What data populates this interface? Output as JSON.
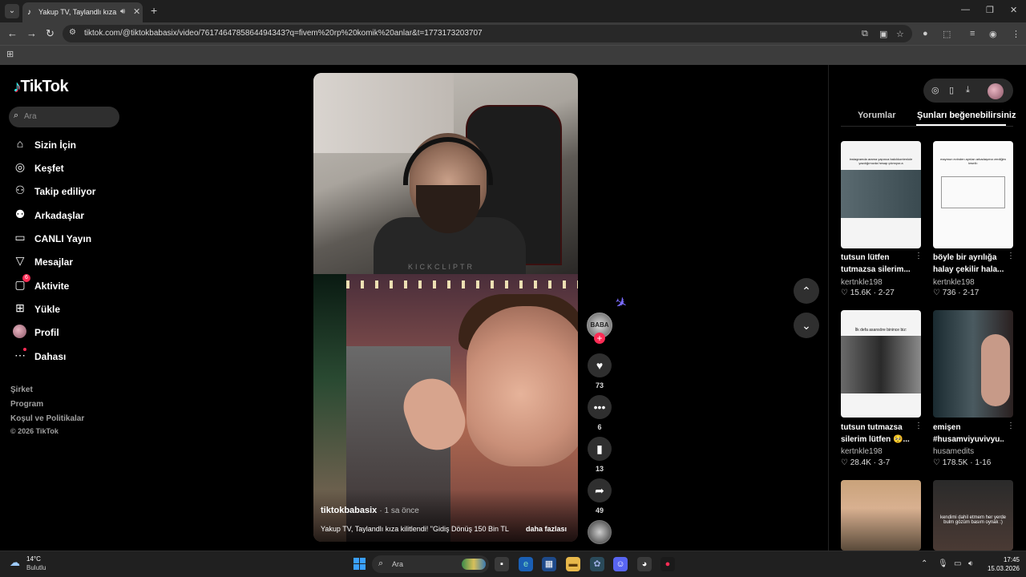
{
  "browser": {
    "tab_title": "Yakup TV, Taylandlı kıza kilit",
    "url": "tiktok.com/@tiktokbabasix/video/7617464785864494343?q=fivem%20rp%20komik%20anlar&t=1773173203707"
  },
  "sidebar": {
    "logo": "TikTok",
    "search_placeholder": "Ara",
    "items": [
      {
        "label": "Sizin İçin",
        "icon": "home-icon"
      },
      {
        "label": "Keşfet",
        "icon": "compass-icon"
      },
      {
        "label": "Takip ediliyor",
        "icon": "following-icon"
      },
      {
        "label": "Arkadaşlar",
        "icon": "friends-icon"
      },
      {
        "label": "CANLI Yayın",
        "icon": "live-icon"
      },
      {
        "label": "Mesajlar",
        "icon": "messages-icon"
      },
      {
        "label": "Aktivite",
        "icon": "activity-icon",
        "badge": "6"
      },
      {
        "label": "Yükle",
        "icon": "upload-icon"
      },
      {
        "label": "Profil",
        "icon": "profile-avatar"
      },
      {
        "label": "Dahası",
        "icon": "more-icon"
      }
    ],
    "footer": [
      "Şirket",
      "Program",
      "Koşul ve Politikalar",
      "© 2026 TikTok"
    ]
  },
  "video": {
    "watermark": "KICKCLIPTR",
    "author": "tiktokbabasix",
    "time": "· 1 sa önce",
    "caption": "Yakup TV, Taylandlı kıza kilitlendi! \"Gidiş Dönüş 150 Bin TL",
    "more": "daha fazlası"
  },
  "actions": {
    "likes": "73",
    "comments": "6",
    "saves": "13",
    "shares": "49"
  },
  "right_panel": {
    "tabs": [
      "Yorumlar",
      "Şunları beğenebilirsiniz"
    ],
    "active_tab": "Şunları beğenebilirsiniz",
    "cards": [
      {
        "title1": "tutsun lütfen",
        "title2": "tutmazsa silerim...",
        "author": "kertnkle198",
        "likes": "15.6K",
        "date": "2-27",
        "overlay": "instagramda arama yapınca bakılıkontenlole yazdığımızda hesap çıkmıyor.a"
      },
      {
        "title1": "böyle bir ayrılığa",
        "title2": "halay çekilir hala...",
        "author": "kertnkle198",
        "likes": "736",
        "date": "2-17",
        "overlay": "maymun evinden ayrılan arkadaşıma verdiğim tesellı:"
      },
      {
        "title1": "tutsun tutmazsa",
        "title2": "silerim lütfen 🥺...",
        "author": "kertnkle198",
        "likes": "28.4K",
        "date": "3-7",
        "overlay": "İlk defa asansöre binince biz:"
      },
      {
        "title1": "emişen",
        "title2": "#husamviyuvivyu...",
        "author": "husamedits",
        "likes": "178.5K",
        "date": "1-16",
        "overlay": ""
      },
      {
        "overlay": ""
      },
      {
        "overlay": "kendimi dahil etmem her yerde bulm gözüm basım oynak :)"
      }
    ]
  },
  "taskbar": {
    "temp": "14°C",
    "weather": "Bulutlu",
    "search_placeholder": "Ara",
    "time": "17:45",
    "date": "15.03.2026"
  }
}
